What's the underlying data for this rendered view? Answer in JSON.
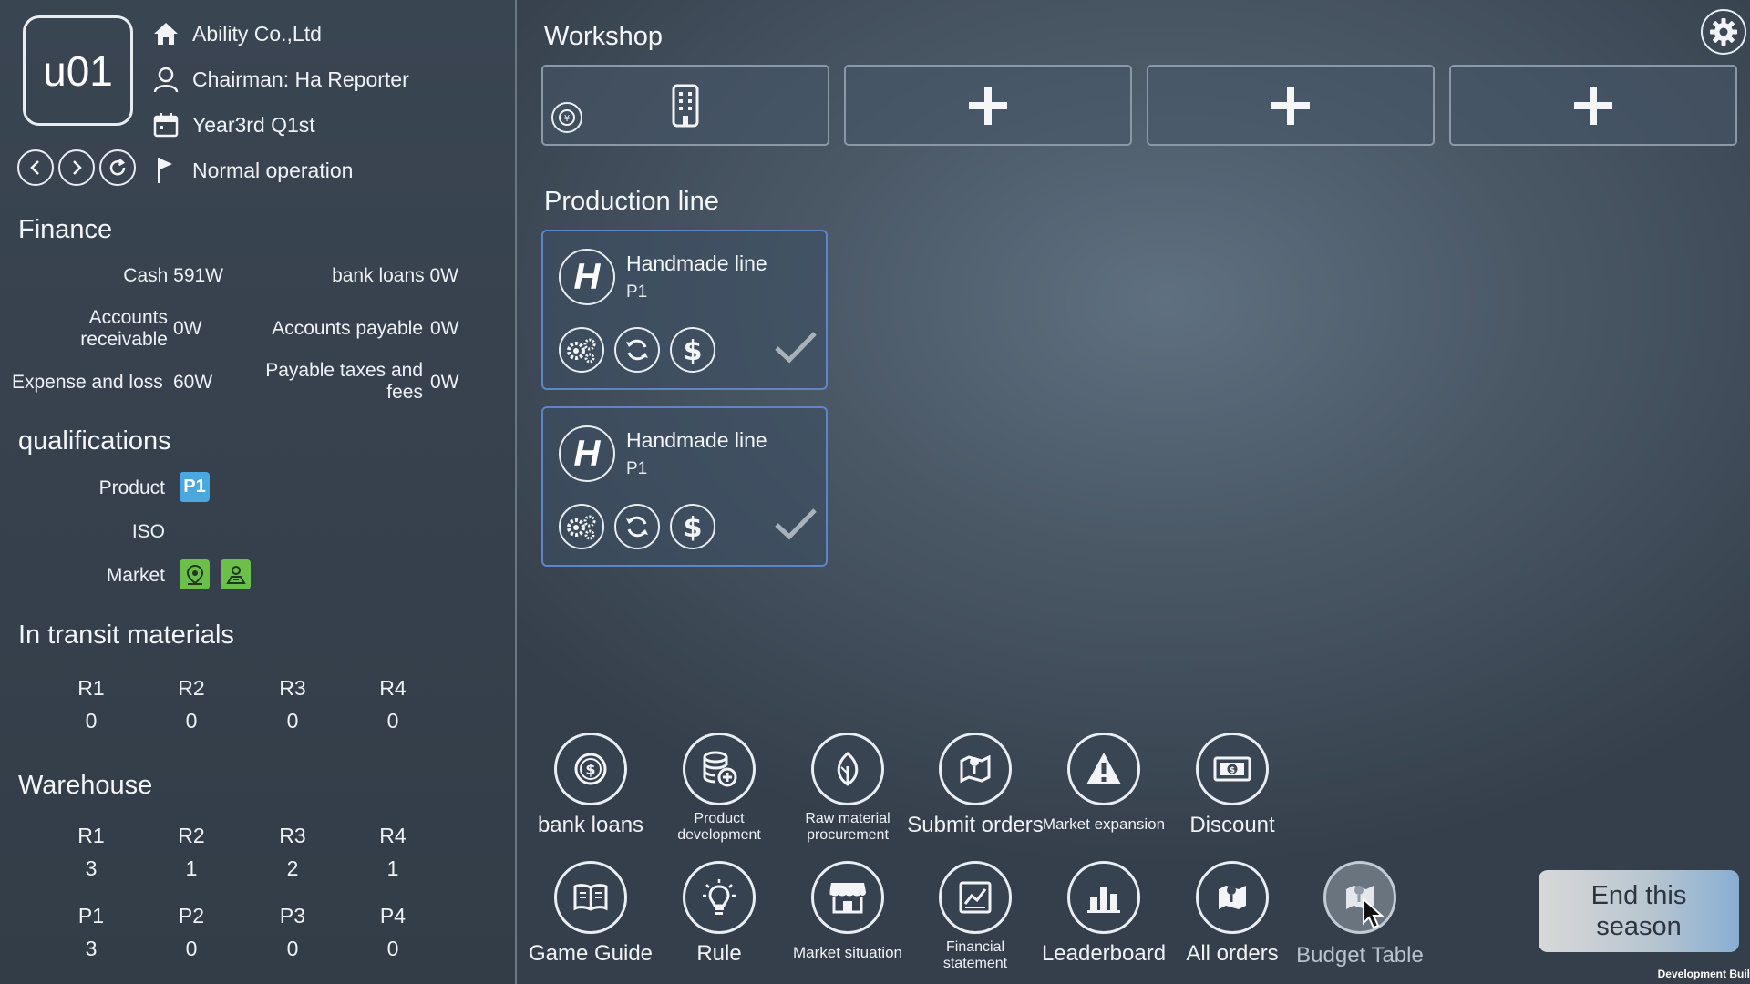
{
  "header": {
    "avatar": "u01",
    "company": "Ability Co.,Ltd",
    "chairman": "Chairman:  Ha Reporter",
    "period": "Year3rd  Q1st",
    "status": "Normal operation"
  },
  "finance": {
    "title": "Finance",
    "cash": "Cash 591W",
    "bank_loans": "bank loans 0W",
    "ar_label": "Accounts receivable",
    "ar_value": "0W",
    "ap_label": "Accounts payable",
    "ap_value": "0W",
    "expense_label": "Expense and loss",
    "expense_value": "60W",
    "taxes_label": "Payable taxes and fees",
    "taxes_value": "0W"
  },
  "qualifications": {
    "title": "qualifications",
    "product_label": "Product",
    "product_badge": "P1",
    "iso_label": "ISO",
    "market_label": "Market"
  },
  "transit": {
    "title": "In transit materials",
    "items": [
      {
        "name": "R1",
        "qty": "0"
      },
      {
        "name": "R2",
        "qty": "0"
      },
      {
        "name": "R3",
        "qty": "0"
      },
      {
        "name": "R4",
        "qty": "0"
      }
    ]
  },
  "warehouse": {
    "title": "Warehouse",
    "raw": [
      {
        "name": "R1",
        "qty": "3"
      },
      {
        "name": "R2",
        "qty": "1"
      },
      {
        "name": "R3",
        "qty": "2"
      },
      {
        "name": "R4",
        "qty": "1"
      }
    ],
    "products": [
      {
        "name": "P1",
        "qty": "3"
      },
      {
        "name": "P2",
        "qty": "0"
      },
      {
        "name": "P3",
        "qty": "0"
      },
      {
        "name": "P4",
        "qty": "0"
      }
    ]
  },
  "workshop": {
    "title": "Workshop"
  },
  "production": {
    "title": "Production line",
    "lines": [
      {
        "name": "Handmade line",
        "product": "P1",
        "type_letter": "H"
      },
      {
        "name": "Handmade line",
        "product": "P1",
        "type_letter": "H"
      }
    ]
  },
  "tools": {
    "bank_loans": "bank loans",
    "product_dev": "Product development",
    "raw_material": "Raw material procurement",
    "submit_orders": "Submit orders",
    "market_expansion": "Market expansion",
    "discount": "Discount",
    "game_guide": "Game Guide",
    "rule": "Rule",
    "market_situation": "Market situation",
    "financial_statement": "Financial statement",
    "leaderboard": "Leaderboard",
    "all_orders": "All orders",
    "budget_table": "Budget Table"
  },
  "end_button": "End this season",
  "dev_build": "Development Buil",
  "colors": {
    "badge_product": "#4aa8e0",
    "badge_market": "#6cbf4a",
    "card_border": "#5f86c4"
  }
}
